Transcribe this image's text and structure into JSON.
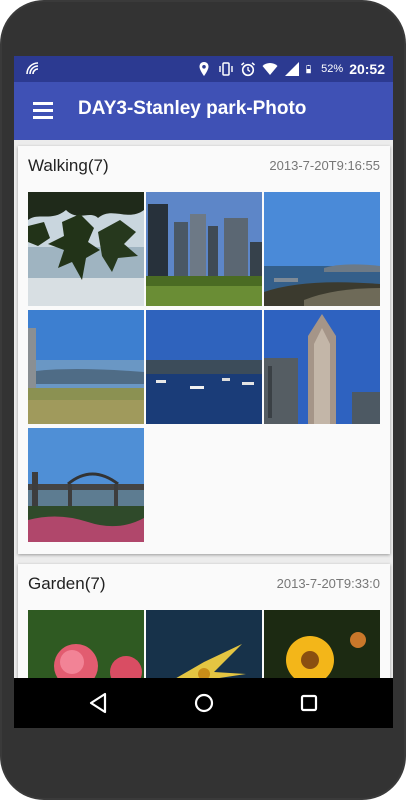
{
  "status_bar": {
    "battery_percent": "52%",
    "time": "20:52",
    "icons": [
      "nfc-icon",
      "location-icon",
      "vibrate-icon",
      "alarm-icon",
      "wifi-icon",
      "signal-icon",
      "battery-icon"
    ]
  },
  "app_bar": {
    "title": "DAY3-Stanley park-Photo",
    "menu_icon": "hamburger-menu-icon"
  },
  "sections": [
    {
      "title": "Walking(7)",
      "timestamp": "2013-7-20T9:16:55",
      "photos": [
        "leaves-over-water",
        "city-towers-park",
        "harbor-shoreline",
        "beach-totem-shore",
        "marina-boats",
        "highrise-tower",
        "bridge-over-creek"
      ]
    },
    {
      "title": "Garden(7)",
      "timestamp": "2013-7-20T9:33:0",
      "photos": [
        "pink-rose",
        "yellow-lily",
        "sunflower"
      ]
    }
  ],
  "nav_bar": {
    "buttons": [
      "back-icon",
      "home-icon",
      "recents-icon"
    ]
  },
  "colors": {
    "status_bar": "#2c3a91",
    "app_bar": "#3f51b5",
    "background": "#ececec",
    "card": "#fafafa"
  }
}
